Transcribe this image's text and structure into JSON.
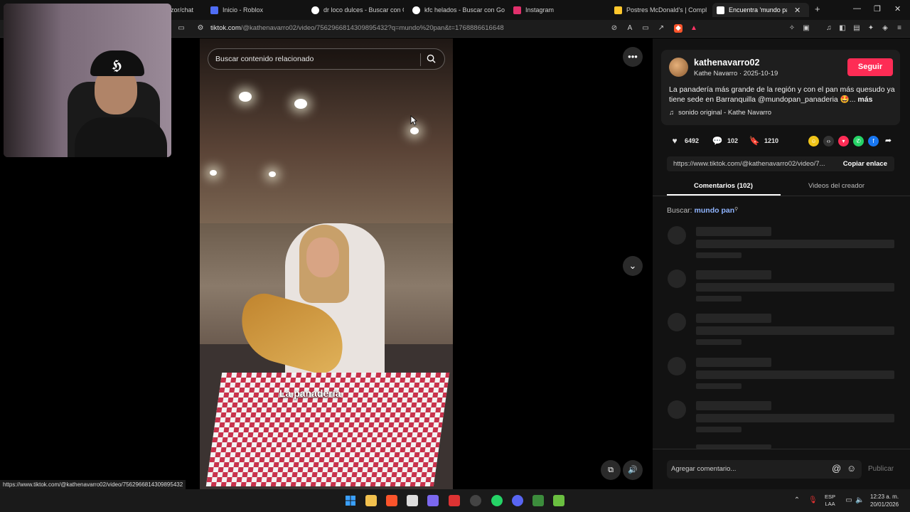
{
  "browser": {
    "tabs": [
      {
        "title": "zor/chat",
        "icon": "tab-icon",
        "color": "#5a5a5a"
      },
      {
        "title": "Inicio - Roblox",
        "icon": "roblox-icon",
        "color": "#4f6df5"
      },
      {
        "title": "dr loco dulces - Buscar con Go",
        "icon": "google-icon",
        "color": "#ffffff"
      },
      {
        "title": "kfc helados - Buscar con Goog",
        "icon": "google-icon",
        "color": "#ffffff"
      },
      {
        "title": "Instagram",
        "icon": "instagram-icon",
        "color": "#e1306c"
      },
      {
        "title": "Postres McDonald's | Complet",
        "icon": "mcdonalds-icon",
        "color": "#ffc72c"
      },
      {
        "title": "Encuentra 'mundo pa",
        "icon": "tiktok-icon",
        "color": "#ffffff",
        "active": true
      }
    ],
    "url_host": "tiktok.com",
    "url_path": "/@kathenavarro02/video/7562966814309895432?q=mundo%20pan&t=1768886616648"
  },
  "video": {
    "search_placeholder": "Buscar contenido relacionado",
    "caption": "La panadería"
  },
  "post": {
    "username": "kathenavarro02",
    "meta": "Kathe Navarro · 2025-10-19",
    "follow_label": "Seguir",
    "description": "La panadería más grande de la región y con el pan más quesudo ya tiene sede en Barranquilla @mundopan_panaderia 🤩...",
    "more_label": "más",
    "sound": "sonido original - Kathe Navarro",
    "likes": "6492",
    "comments": "102",
    "saves": "1210",
    "share_link": "https://www.tiktok.com/@kathenavarro02/video/7...",
    "copy_label": "Copiar enlace"
  },
  "tabs": {
    "comments": "Comentarios (102)",
    "creator": "Videos del creador"
  },
  "search_hint": {
    "label": "Buscar:",
    "query": "mundo pan"
  },
  "composer": {
    "placeholder": "Agregar comentario...",
    "publish_label": "Publicar"
  },
  "status_url": "https://www.tiktok.com/@kathenavarro02/video/7562966814309895432",
  "system": {
    "lang1": "ESP",
    "lang2": "LAA",
    "time": "12:23 a. m.",
    "date": "20/01/2026"
  },
  "colors": {
    "accent": "#fe2c55",
    "link_blue": "#8fb4ff"
  }
}
